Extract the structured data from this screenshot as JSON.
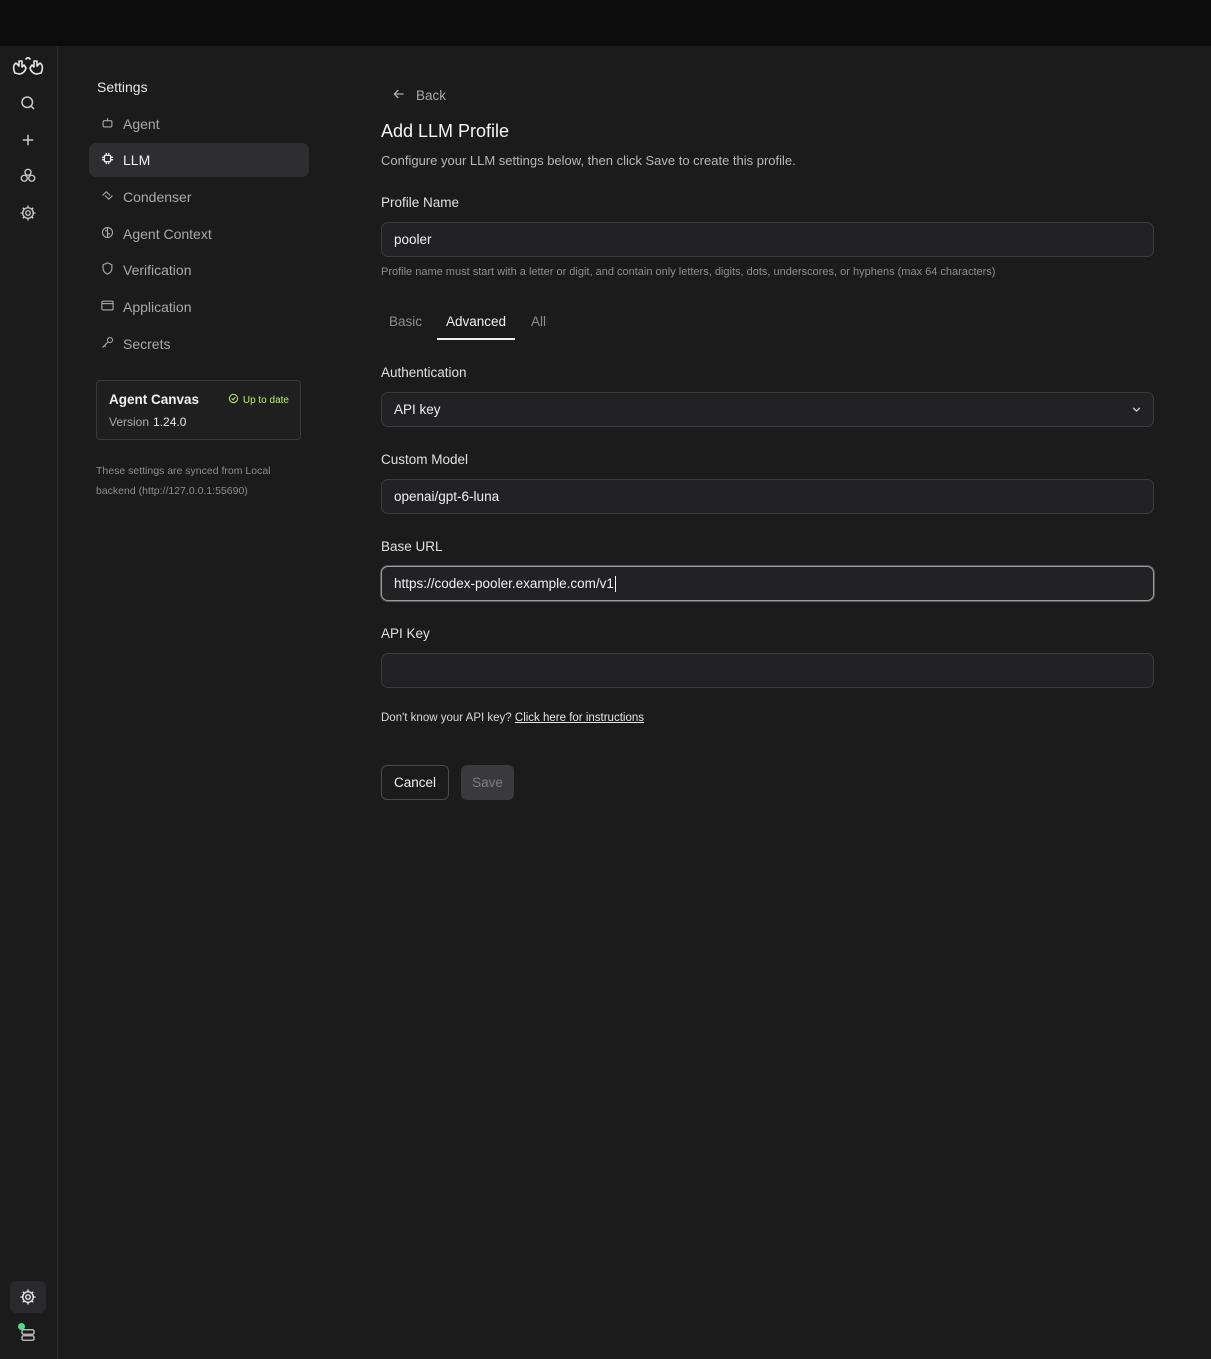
{
  "settings": {
    "title": "Settings",
    "nav": [
      {
        "label": "Agent",
        "icon": "robot-icon"
      },
      {
        "label": "LLM",
        "icon": "chip-icon",
        "active": true
      },
      {
        "label": "Condenser",
        "icon": "compress-icon"
      },
      {
        "label": "Agent Context",
        "icon": "brain-icon"
      },
      {
        "label": "Verification",
        "icon": "shield-icon"
      },
      {
        "label": "Application",
        "icon": "window-icon"
      },
      {
        "label": "Secrets",
        "icon": "key-icon"
      }
    ],
    "version_card": {
      "name": "Agent Canvas",
      "status": "Up to date",
      "version_label": "Version",
      "version": "1.24.0"
    },
    "sync_note": "These settings are synced from Local backend (http://127.0.0.1:55690)"
  },
  "main": {
    "back_label": "Back",
    "title": "Add LLM Profile",
    "subtitle": "Configure your LLM settings below, then click Save to create this profile.",
    "profile_name": {
      "label": "Profile Name",
      "value": "pooler",
      "hint": "Profile name must start with a letter or digit, and contain only letters, digits, dots, underscores, or hyphens (max 64 characters)"
    },
    "tabs": [
      "Basic",
      "Advanced",
      "All"
    ],
    "active_tab": "Advanced",
    "authentication": {
      "label": "Authentication",
      "value": "API key"
    },
    "custom_model": {
      "label": "Custom Model",
      "value": "openai/gpt-6-luna"
    },
    "base_url": {
      "label": "Base URL",
      "value": "https://codex-pooler.example.com/v1"
    },
    "api_key": {
      "label": "API Key",
      "value": ""
    },
    "help": {
      "text": "Don't know your API key?",
      "link": "Click here for instructions"
    },
    "buttons": {
      "cancel": "Cancel",
      "save": "Save"
    }
  },
  "colors": {
    "background": "#1b1b1c",
    "accent_status": "#b7f06a",
    "online_dot": "#4ade80"
  }
}
